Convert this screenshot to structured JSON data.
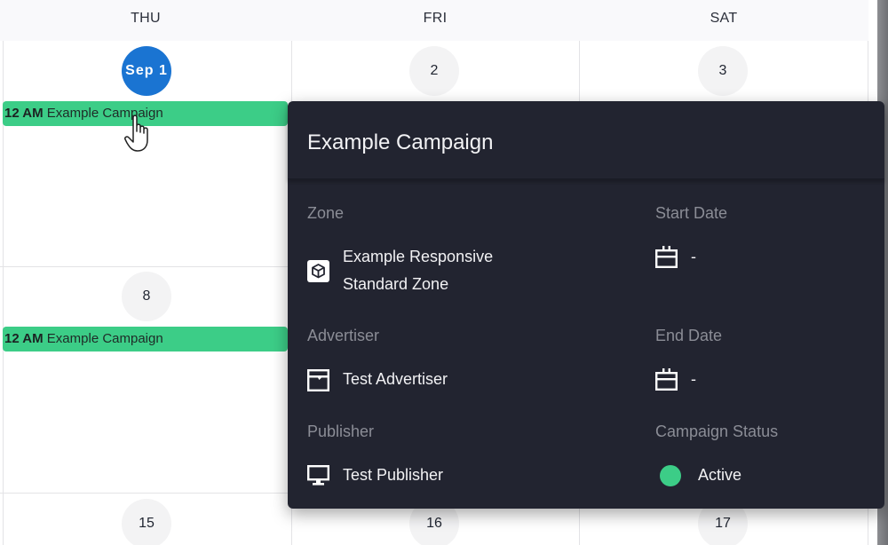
{
  "calendar": {
    "weekdays": [
      "THU",
      "FRI",
      "SAT"
    ],
    "rows": [
      {
        "days": [
          "Sep 1",
          "2",
          "3"
        ]
      },
      {
        "days": [
          "8",
          "",
          ""
        ]
      },
      {
        "days": [
          "15",
          "16",
          "17"
        ]
      }
    ],
    "events": [
      {
        "time": "12 AM",
        "title": "Example Campaign"
      },
      {
        "time": "12 AM",
        "title": "Example Campaign"
      }
    ]
  },
  "popup": {
    "title": "Example Campaign",
    "zone": {
      "label": "Zone",
      "value_line1": "Example Responsive",
      "value_line2": "Standard Zone",
      "icon": "cube-icon"
    },
    "advertiser": {
      "label": "Advertiser",
      "value": "Test Advertiser",
      "icon": "storefront-icon"
    },
    "publisher": {
      "label": "Publisher",
      "value": "Test Publisher",
      "icon": "monitor-icon"
    },
    "start_date": {
      "label": "Start Date",
      "value": "-",
      "icon": "calendar-icon"
    },
    "end_date": {
      "label": "End Date",
      "value": "-",
      "icon": "calendar-icon"
    },
    "status": {
      "label": "Campaign Status",
      "value": "Active",
      "color": "#3ccd87"
    }
  },
  "colors": {
    "today": "#1a74d2",
    "event": "#3ccd87",
    "popup_bg": "#222430"
  }
}
